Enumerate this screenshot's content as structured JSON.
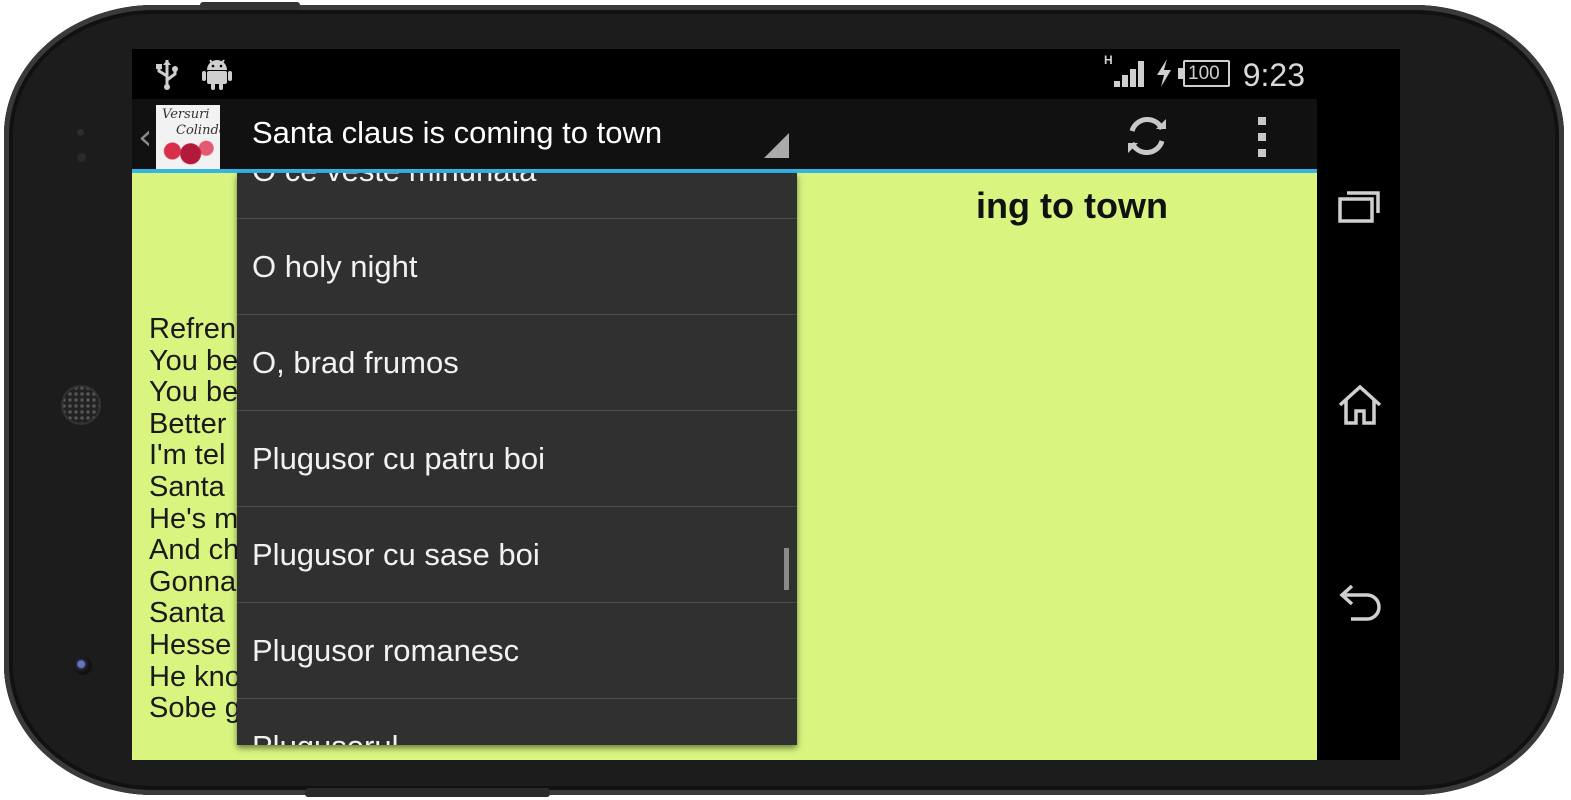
{
  "status_bar": {
    "network_type": "H",
    "battery": "100",
    "time": "9:23",
    "icons": [
      "usb-icon",
      "android-icon",
      "signal-icon",
      "charging-icon",
      "battery-icon"
    ]
  },
  "action_bar": {
    "app_icon_text": [
      "Versuri",
      "Colinde"
    ],
    "selected_song": "Santa claus is coming to town",
    "accent_color": "#33b5e5"
  },
  "content": {
    "background_color": "#d9f580",
    "title_visible": "ing to town",
    "lyrics_visible": [
      "Refren",
      "You be",
      "You be",
      "Better",
      "I'm tel",
      "Santa",
      "He's m",
      "And ch",
      "Gonna",
      "Santa",
      "Hesse",
      "He kno",
      "Sobe g"
    ]
  },
  "dropdown": {
    "items": [
      "O ce veste minunata",
      "O holy night",
      "O, brad frumos",
      "Plugusor cu patru boi",
      "Plugusor cu sase boi",
      "Plugusor romanesc",
      "Plugusorul"
    ]
  },
  "nav_bar": {
    "buttons": [
      "recent-apps-icon",
      "home-icon",
      "back-icon"
    ]
  }
}
